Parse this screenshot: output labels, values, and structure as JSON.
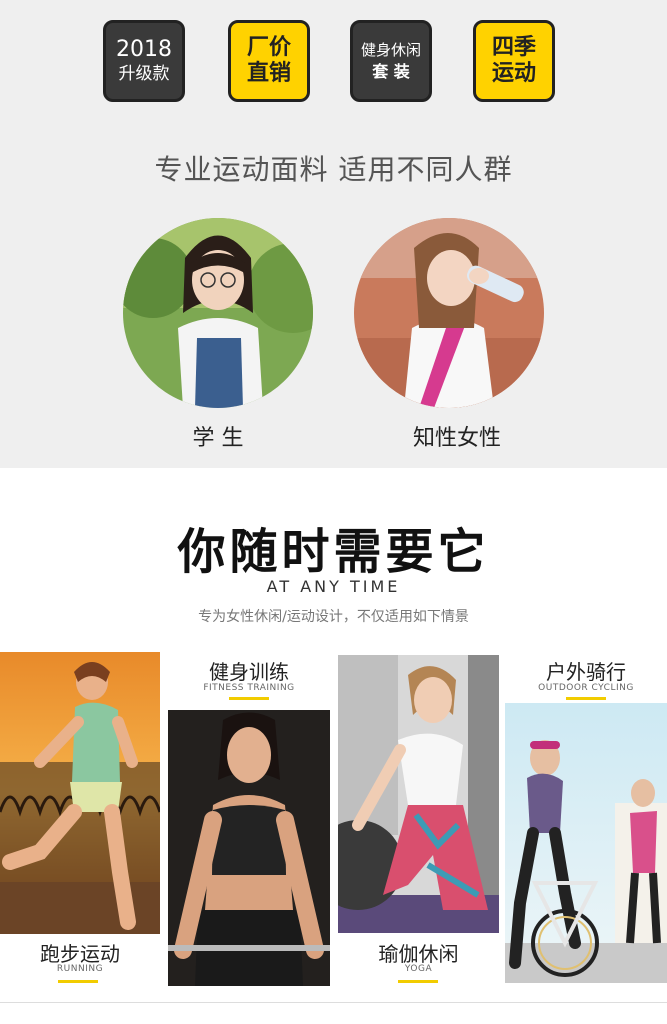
{
  "badges": [
    {
      "line1": "2018",
      "line2": "升级款"
    },
    {
      "line1": "厂价",
      "line2": "直销"
    },
    {
      "line1": "健身休闲",
      "line2": "套 装"
    },
    {
      "line1": "四季",
      "line2": "运动"
    }
  ],
  "subtitle": "专业运动面料 适用不同人群",
  "people": [
    {
      "label": "学 生"
    },
    {
      "label": "知性女性"
    }
  ],
  "heading": "你随时需要它",
  "heading_en": "AT ANY TIME",
  "description": "专为女性休闲/运动设计，不仅适用如下情景",
  "scenes": [
    {
      "cn": "跑步运动",
      "en": "RUNNING"
    },
    {
      "cn": "健身训练",
      "en": "FITNESS TRAINING"
    },
    {
      "cn": "瑜伽休闲",
      "en": "YOGA"
    },
    {
      "cn": "户外骑行",
      "en": "OUTDOOR CYCLING"
    }
  ],
  "colors": {
    "accent": "#ffd200",
    "badge_dark": "#3a3a3a",
    "bg_top": "#efefef"
  }
}
